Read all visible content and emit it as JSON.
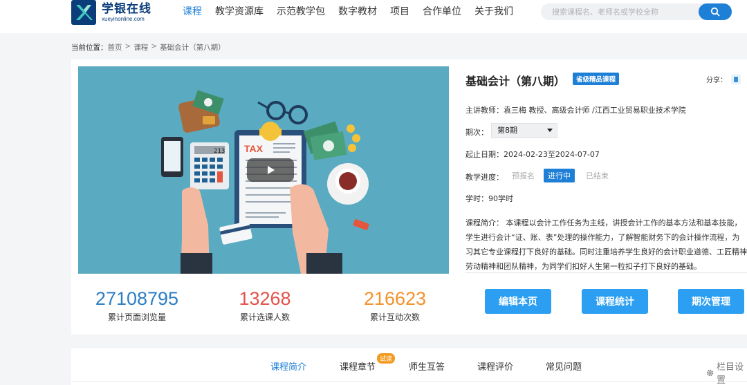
{
  "header": {
    "logo_cn": "学银在线",
    "logo_en": "xueyinonline.com",
    "nav": [
      "课程",
      "教学资源库",
      "示范教学包",
      "数字教材",
      "项目",
      "合作单位",
      "关于我们"
    ],
    "active_nav": "课程",
    "search_placeholder": "搜索课程名、老师名或学校全称"
  },
  "breadcrumb": {
    "label": "当前位置：",
    "items": [
      "首页",
      "课程",
      "基础会计（第八期）"
    ]
  },
  "course": {
    "title": "基础会计（第八期）",
    "badge": "省级精品课程",
    "share_label": "分享：",
    "teacher_label": "主讲教师：",
    "teacher": "袁三梅 教授、高级会计师 /江西工业贸易职业技术学院",
    "term_label": "期次：",
    "term_value": "第8期",
    "date_label": "起止日期：",
    "dates": "2024-02-23至2024-07-07",
    "progress_label": "教学进度：",
    "progress_states": [
      "预报名",
      "进行中",
      "已结束"
    ],
    "hours_label": "学时：",
    "hours": "90学时",
    "desc_lines": [
      "课程简介： 本课程以会计工作任务为主线，讲授会计工作的基本方法和基本技能，",
      "学生进行会计“证、账、表”处理的操作能力，了解智能财务下的会计操作流程，为",
      "习其它专业课程打下良好的基础。同时注重培养学生良好的会计职业道德、工匠精神",
      "劳动精神和团队精神，为同学们扣好人生第一粒扣子打下良好的基础。"
    ],
    "buttons": [
      "编辑本页",
      "课程统计",
      "期次管理"
    ]
  },
  "stats": [
    {
      "value": "27108795",
      "label": "累计页面浏览量",
      "color": "#2d7ec4"
    },
    {
      "value": "13268",
      "label": "累计选课人数",
      "color": "#e2534b"
    },
    {
      "value": "216623",
      "label": "累计互动次数",
      "color": "#f2922a"
    }
  ],
  "cover": {
    "tax_text": "TAX",
    "calc_display": "213"
  },
  "tabs": {
    "items": [
      "课程简介",
      "课程章节",
      "师生互答",
      "课程评价",
      "常见问题"
    ],
    "active": "课程简介",
    "trial_badge": "试读",
    "settings": "栏目设置"
  },
  "colors": {
    "primary": "#1e7fd6",
    "button": "#2d9ff2",
    "cover_bg": "#5aabc2"
  }
}
